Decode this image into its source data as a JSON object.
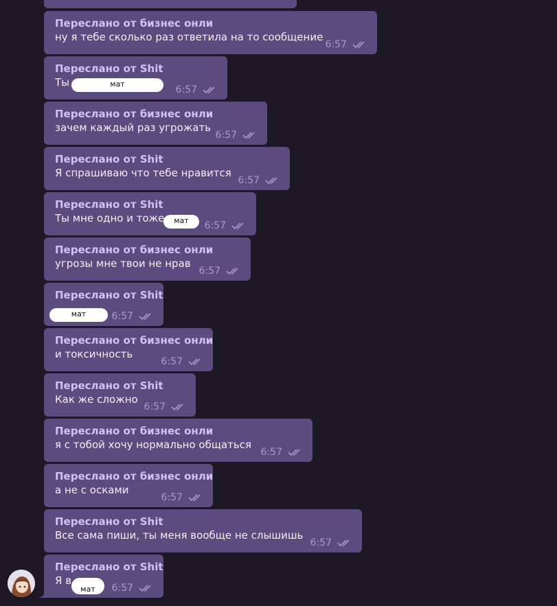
{
  "messages": [
    {
      "forwarded_from": "Переслано от бизнес онли",
      "text": "ну я тебе сколько раз ответила на то сообщение",
      "time": "6:57"
    },
    {
      "forwarded_from": "Переслано от Shit",
      "text": "Ты",
      "redaction": "мат",
      "trailing": "?",
      "time": "6:57"
    },
    {
      "forwarded_from": "Переслано от бизнес онли",
      "text": "зачем каждый раз угрожать",
      "time": "6:57"
    },
    {
      "forwarded_from": "Переслано от Shit",
      "text": "Я спрашиваю что тебе нравится",
      "time": "6:57"
    },
    {
      "forwarded_from": "Переслано от Shit",
      "text": "Ты мне одно и тоже",
      "redaction": "мат",
      "time": "6:57"
    },
    {
      "forwarded_from": "Переслано от бизнес онли",
      "text": "угрозы мне твои не нрав",
      "time": "6:57"
    },
    {
      "forwarded_from": "Переслано от Shit",
      "text": "",
      "redaction": "мат",
      "time": "6:57"
    },
    {
      "forwarded_from": "Переслано от бизнес онли",
      "text": "и токсичность",
      "time": "6:57"
    },
    {
      "forwarded_from": "Переслано от Shit",
      "text": "Как же сложно",
      "time": "6:57"
    },
    {
      "forwarded_from": "Переслано от бизнес онли",
      "text": "я с тобой хочу нормально общаться",
      "time": "6:57"
    },
    {
      "forwarded_from": "Переслано от бизнес онли",
      "text": "а не с осками",
      "time": "6:57"
    },
    {
      "forwarded_from": "Переслано от Shit",
      "text": "Все сама пиши, ты меня вообще не слышишь",
      "time": "6:57"
    },
    {
      "forwarded_from": "Переслано от Shit",
      "text": "Я в",
      "redaction": "мат",
      "time": "6:57"
    }
  ],
  "colors": {
    "background": "#1c1924",
    "bubble": "#5b4b7e",
    "forward_label": "#d2c1f7",
    "text": "#f1effa",
    "meta": "#a89cc8"
  },
  "icons": {
    "read_status": "double-check-icon",
    "avatar": "user-avatar"
  }
}
